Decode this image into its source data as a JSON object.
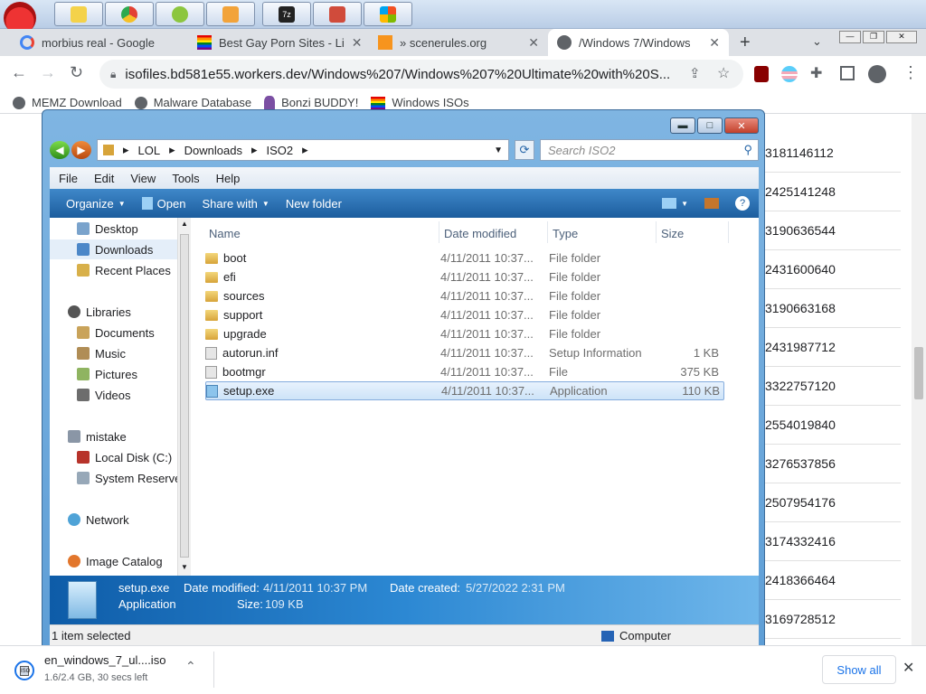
{
  "taskbar": {
    "buttons": [
      "explorer",
      "chrome",
      "frog",
      "people",
      "7z",
      "paint",
      "windows"
    ]
  },
  "tabs": [
    {
      "title": "morbius real - Google"
    },
    {
      "title": "Best Gay Porn Sites - Li"
    },
    {
      "title": "» scenerules.org"
    },
    {
      "title": "/Windows 7/Windows"
    }
  ],
  "omnibox": {
    "url": "isofiles.bd581e55.workers.dev/Windows%207/Windows%207%20Ultimate%20with%20S..."
  },
  "bookmarks": [
    "MEMZ Download",
    "Malware Database",
    "Bonzi BUDDY!",
    "Windows ISOs"
  ],
  "page_numbers": [
    "3181146112",
    "2425141248",
    "3190636544",
    "2431600640",
    "3190663168",
    "2431987712",
    "3322757120",
    "2554019840",
    "3276537856",
    "2507954176",
    "3174332416",
    "2418366464",
    "3169728512"
  ],
  "explorer": {
    "breadcrumb": [
      "LOL",
      "Downloads",
      "ISO2"
    ],
    "search_placeholder": "Search ISO2",
    "menu": [
      "File",
      "Edit",
      "View",
      "Tools",
      "Help"
    ],
    "commands": [
      "Organize",
      "Open",
      "Share with",
      "New folder"
    ],
    "nav": {
      "favorites": [
        "Desktop",
        "Downloads",
        "Recent Places"
      ],
      "libraries_title": "Libraries",
      "libraries": [
        "Documents",
        "Music",
        "Pictures",
        "Videos"
      ],
      "computer_title": "mistake",
      "drives": [
        "Local Disk (C:)",
        "System Reserve"
      ],
      "network": "Network",
      "catalog": "Image Catalog"
    },
    "columns": [
      "Name",
      "Date modified",
      "Type",
      "Size"
    ],
    "files": [
      {
        "name": "boot",
        "date": "4/11/2011 10:37...",
        "type": "File folder",
        "size": "",
        "kind": "folder"
      },
      {
        "name": "efi",
        "date": "4/11/2011 10:37...",
        "type": "File folder",
        "size": "",
        "kind": "folder"
      },
      {
        "name": "sources",
        "date": "4/11/2011 10:37...",
        "type": "File folder",
        "size": "",
        "kind": "folder"
      },
      {
        "name": "support",
        "date": "4/11/2011 10:37...",
        "type": "File folder",
        "size": "",
        "kind": "folder"
      },
      {
        "name": "upgrade",
        "date": "4/11/2011 10:37...",
        "type": "File folder",
        "size": "",
        "kind": "folder"
      },
      {
        "name": "autorun.inf",
        "date": "4/11/2011 10:37...",
        "type": "Setup Information",
        "size": "1 KB",
        "kind": "file"
      },
      {
        "name": "bootmgr",
        "date": "4/11/2011 10:37...",
        "type": "File",
        "size": "375 KB",
        "kind": "file"
      },
      {
        "name": "setup.exe",
        "date": "4/11/2011 10:37...",
        "type": "Application",
        "size": "110 KB",
        "kind": "app"
      }
    ],
    "details": {
      "name": "setup.exe",
      "type": "Application",
      "date_modified_label": "Date modified:",
      "date_modified": "4/11/2011 10:37 PM",
      "date_created_label": "Date created:",
      "date_created": "5/27/2022 2:31 PM",
      "size_label": "Size:",
      "size": "109 KB"
    },
    "status": {
      "selected": "1 item selected",
      "location": "Computer"
    }
  },
  "download": {
    "filename": "en_windows_7_ul....iso",
    "progress": "1.6/2.4 GB, 30 secs left",
    "show_all": "Show all"
  }
}
